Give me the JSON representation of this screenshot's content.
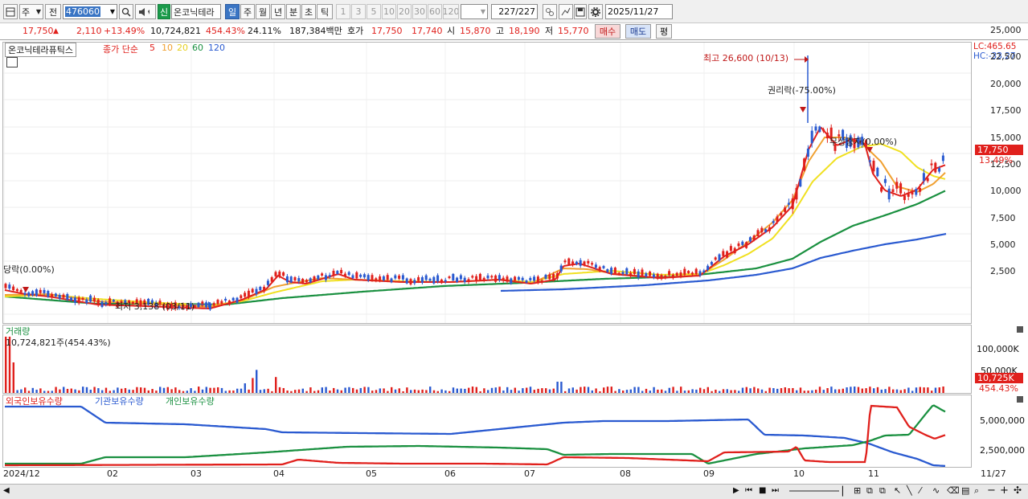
{
  "toolbar": {
    "type_label": "주",
    "prev_label": "전",
    "code_value": "476060",
    "new_badge": "신",
    "stock_name": "온코닉테라",
    "periods": [
      "일",
      "주",
      "월",
      "년",
      "분",
      "초",
      "틱"
    ],
    "intervals": [
      "1",
      "3",
      "5",
      "10",
      "20",
      "30",
      "60",
      "120"
    ],
    "count_value": "227",
    "count_total": "/227",
    "date_value": "2025/11/27"
  },
  "quote": {
    "price": "17,750",
    "change": "2,110",
    "change_pct": "+13.49%",
    "volume": "10,724,821",
    "volume_pct": "454.43%",
    "turnover": "24.11%",
    "amount": "187,384백만",
    "hoga_label": "호가",
    "ask": "17,750",
    "bid": "17,740",
    "open_label": "시",
    "open": "15,870",
    "high_label": "고",
    "high": "18,190",
    "low_label": "저",
    "low": "15,770",
    "buy_label": "매수",
    "sell_label": "매도",
    "eval_label": "평"
  },
  "price_panel": {
    "stock_label": "온코닉테라퓨틱스",
    "ma_title": "종가 단순",
    "ma_periods": [
      "5",
      "10",
      "20",
      "60",
      "120"
    ],
    "ma_colors": [
      "#e0201c",
      "#f0a030",
      "#f0e020",
      "#1a9040",
      "#2a5ad0"
    ],
    "top_right_lc": "LC:465.65",
    "top_right_hc": "HC:-33.27",
    "price_ticks": [
      "25,000",
      "22,500",
      "20,000",
      "17,500",
      "15,000",
      "12,500",
      "10,000",
      "7,500",
      "5,000",
      "2,500"
    ],
    "last_price": "17,750",
    "last_pct": "13.49%",
    "ann_high": "최고 26,600 (10/13)",
    "ann_low": "최저 3,138 (03/11)",
    "ann_rights": "권리락(-75.00%)",
    "ann_left": "당락(0.00%)",
    "ann_mid": "무상증자(0.00%)"
  },
  "volume_panel": {
    "title": "거래량",
    "info": "10,724,821주(454.43%)",
    "ticks": [
      "100,000K",
      "50,000K"
    ],
    "last": "10,725K",
    "last_pct": "454.43%"
  },
  "holding_panel": {
    "series": [
      "외국인보유수량",
      "기관보유수량",
      "개인보유수량"
    ],
    "series_colors": [
      "#e0201c",
      "#2a5ad0",
      "#1a9040"
    ],
    "ticks": [
      "5,000,000",
      "2,500,000"
    ]
  },
  "x_axis": {
    "months": [
      "2024/12",
      "02",
      "03",
      "04",
      "05",
      "06",
      "07",
      "08",
      "09",
      "10",
      "11"
    ],
    "right_label": "11/27"
  },
  "colors": {
    "up": "#e0201c",
    "down": "#2a5ad0",
    "accent": "#3a75c4"
  }
}
